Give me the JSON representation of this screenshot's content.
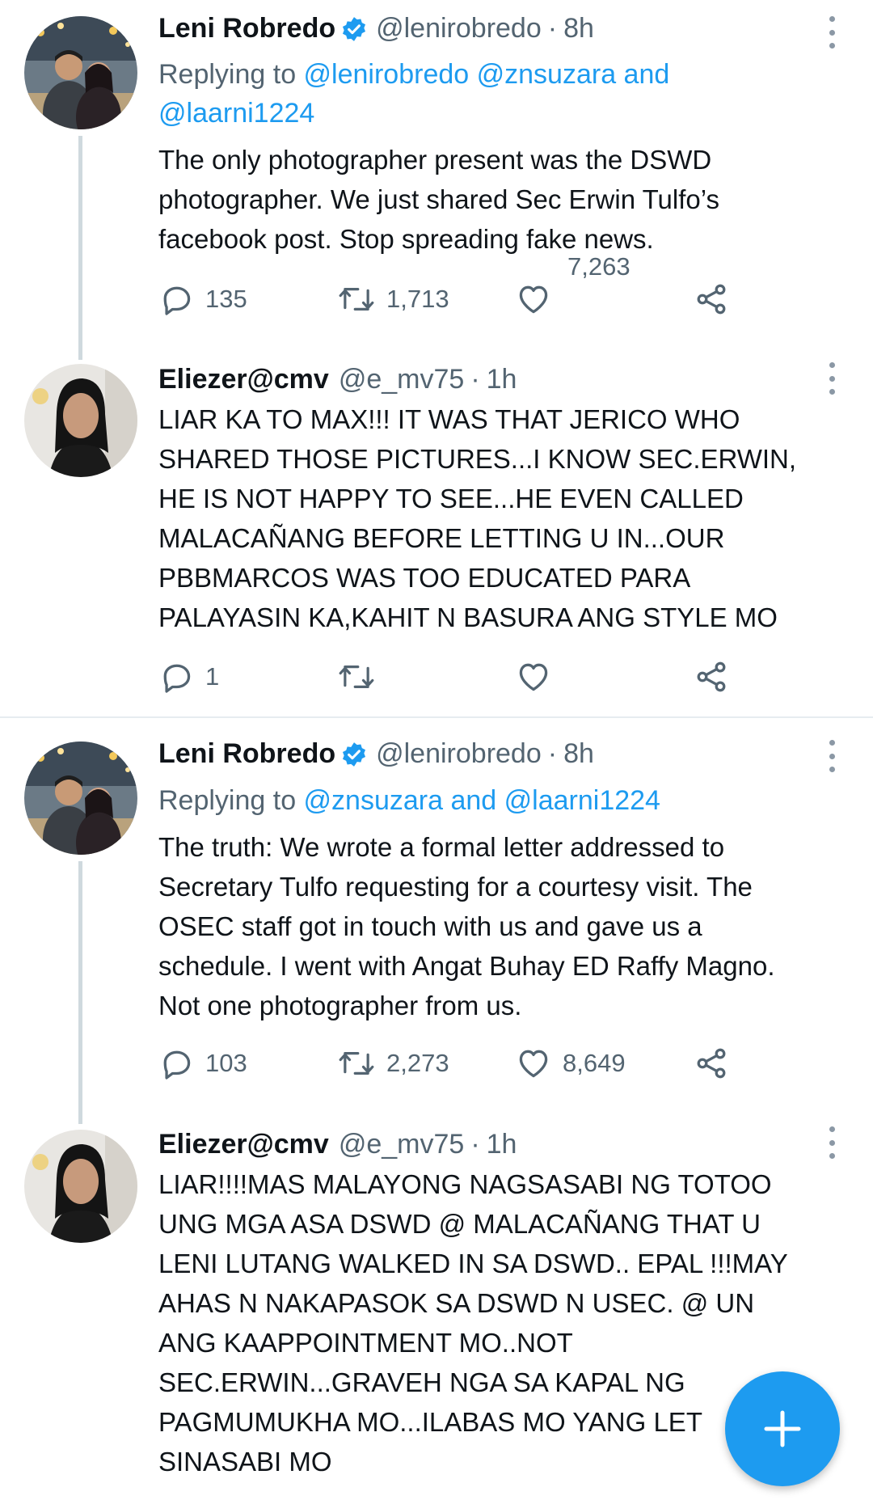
{
  "tweets": [
    {
      "name": "Leni Robredo",
      "verified": true,
      "handle": "@lenirobredo",
      "dot": "·",
      "time": "8h",
      "replying_prefix": "Replying to ",
      "replying_line1": "@lenirobredo @znsuzara and",
      "replying_line2": "@laarni1224",
      "text": "The only photographer present was the DSWD\nphotographer. We just shared Sec Erwin Tulfo’s\nfacebook post. Stop spreading fake news.",
      "replies": "135",
      "retweets": "1,713",
      "likes": "7,263"
    },
    {
      "name": "Eliezer@cmv",
      "handle": "@e_mv75",
      "dot": "·",
      "time": "1h",
      "text": "LIAR KA TO MAX!!! IT WAS THAT JERICO WHO\nSHARED THOSE PICTURES...I KNOW SEC.ERWIN,\nHE IS NOT HAPPY TO SEE...HE EVEN CALLED\nMALACAÑANG BEFORE LETTING U IN...OUR\nPBBMARCOS WAS TOO EDUCATED PARA\nPALAYASIN KA,KAHIT N BASURA ANG STYLE MO",
      "replies": "1"
    },
    {
      "name": "Leni Robredo",
      "verified": true,
      "handle": "@lenirobredo",
      "dot": "·",
      "time": "8h",
      "replying_prefix": "Replying to ",
      "replying_line1": "@znsuzara and @laarni1224",
      "text": "The truth: We wrote a formal letter addressed to\nSecretary Tulfo requesting for a courtesy visit. The\nOSEC staff got in touch with us and gave us a\nschedule. I went with Angat Buhay ED Raffy Magno.\nNot one photographer from us.",
      "replies": "103",
      "retweets": "2,273",
      "likes": "8,649"
    },
    {
      "name": "Eliezer@cmv",
      "handle": "@e_mv75",
      "dot": "·",
      "time": "1h",
      "text": "LIAR!!!!MAS MALAYONG NAGSASABI NG TOTOO\nUNG MGA ASA DSWD @ MALACAÑANG  THAT U\nLENI LUTANG WALKED IN SA DSWD.. EPAL !!!MAY\nAHAS N NAKAPASOK SA DSWD N USEC. @ UN\nANG KAAPPOINTMENT  MO..NOT\nSEC.ERWIN...GRAVEH NGA SA KAPAL NG\nPAGMUMUKHA MO...ILABAS MO YANG LET\nSINASABI MO"
    }
  ],
  "icons": {
    "reply": "reply-icon",
    "retweet": "retweet-icon",
    "like": "heart-icon",
    "share": "share-icon",
    "more": "more-icon",
    "verified": "verified-badge-icon",
    "compose": "plus-icon"
  },
  "colors": {
    "accent": "#1d9bf0",
    "muted": "#536471",
    "text": "#0f1419"
  }
}
